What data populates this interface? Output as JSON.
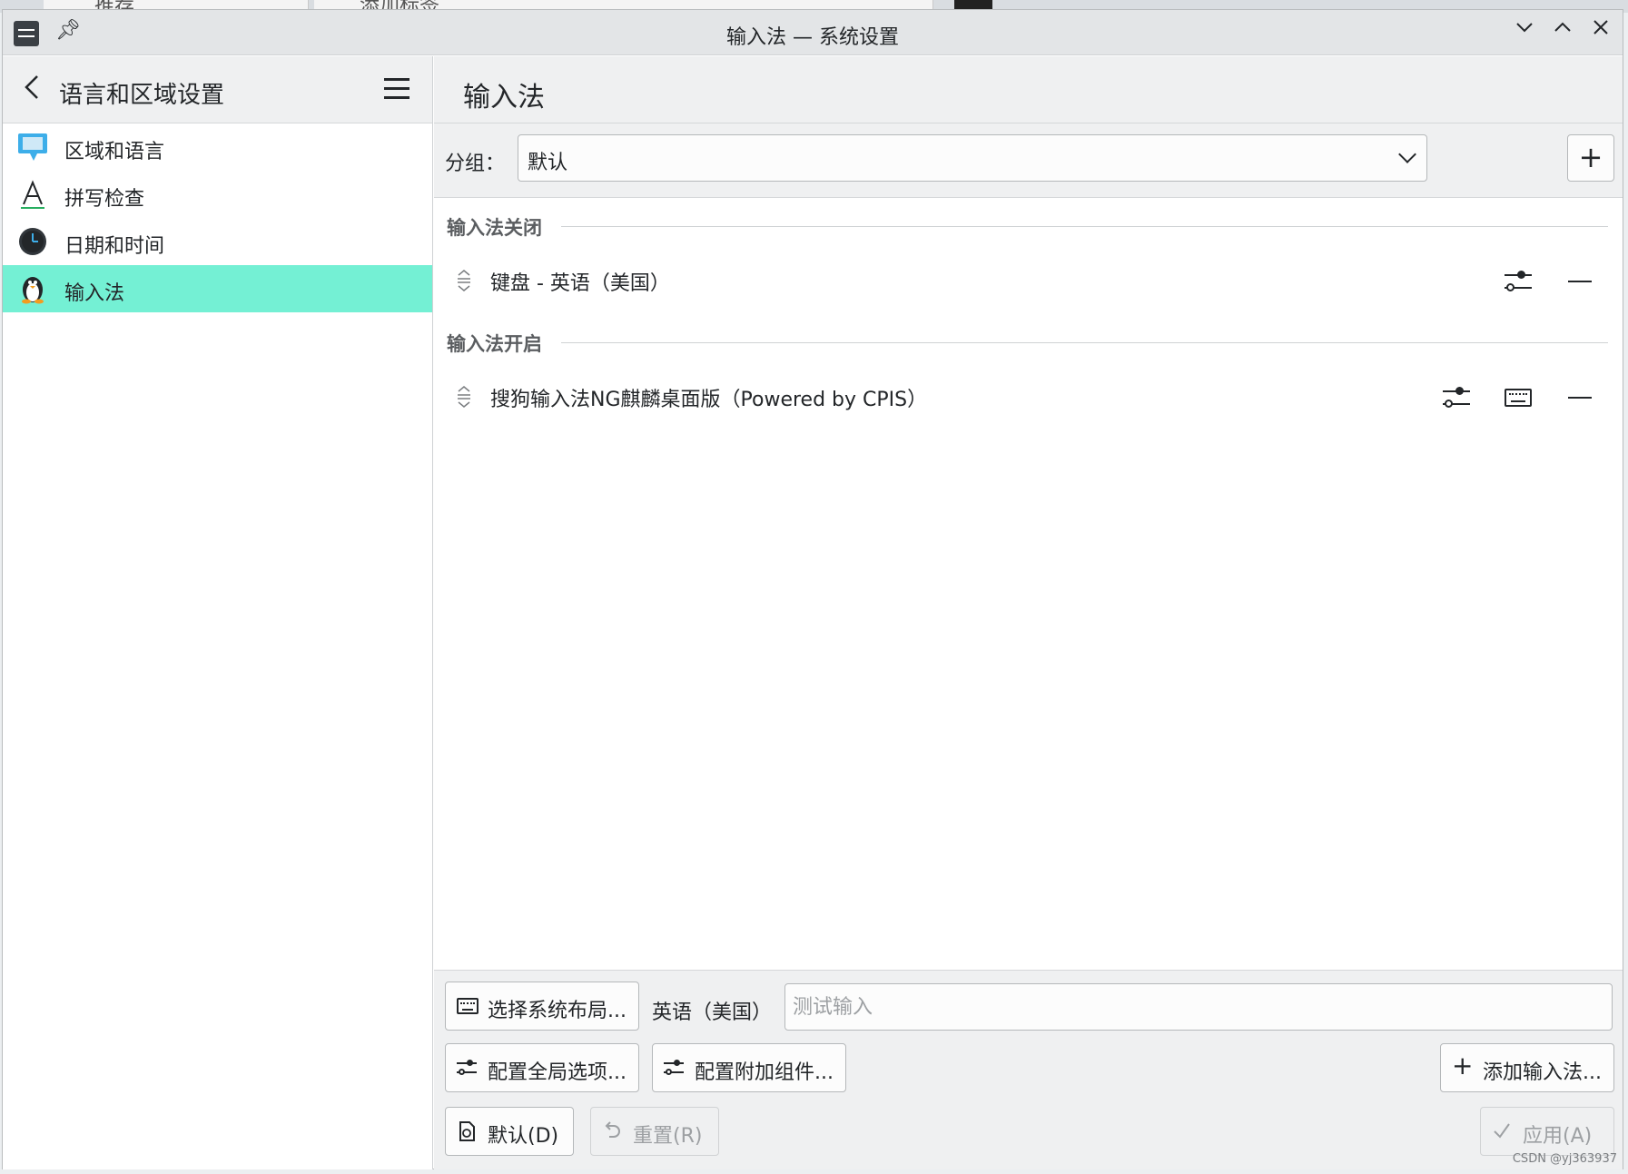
{
  "background": {
    "tab1": "推荐",
    "tab2": "添加标签"
  },
  "window": {
    "title": "输入法 — 系统设置"
  },
  "sidebar": {
    "title": "语言和区域设置",
    "items": [
      {
        "label": "区域和语言",
        "icon": "chat-bubble-icon"
      },
      {
        "label": "拼写检查",
        "icon": "letter-a-icon"
      },
      {
        "label": "日期和时间",
        "icon": "clock-icon"
      },
      {
        "label": "输入法",
        "icon": "penguin-icon"
      }
    ]
  },
  "main": {
    "title": "输入法",
    "group": {
      "label": "分组：",
      "value": "默认"
    },
    "sections": [
      {
        "title": "输入法关闭",
        "items": [
          {
            "name": "键盘 - 英语（美国）"
          }
        ]
      },
      {
        "title": "输入法开启",
        "items": [
          {
            "name": "搜狗输入法NG麒麟桌面版（Powered by CPIS）"
          }
        ]
      }
    ]
  },
  "bottom": {
    "select_layout": "选择系统布局...",
    "layout_name": "英语（美国）",
    "test_input_placeholder": "测试输入",
    "config_global": "配置全局选项...",
    "config_addons": "配置附加组件...",
    "add_im": "添加输入法...",
    "defaults": "默认(D)",
    "reset": "重置(R)",
    "apply": "应用(A)"
  },
  "watermark": "CSDN @yj363937",
  "colors": {
    "active_item": "#74f0d4",
    "accent": "#3daee9"
  }
}
